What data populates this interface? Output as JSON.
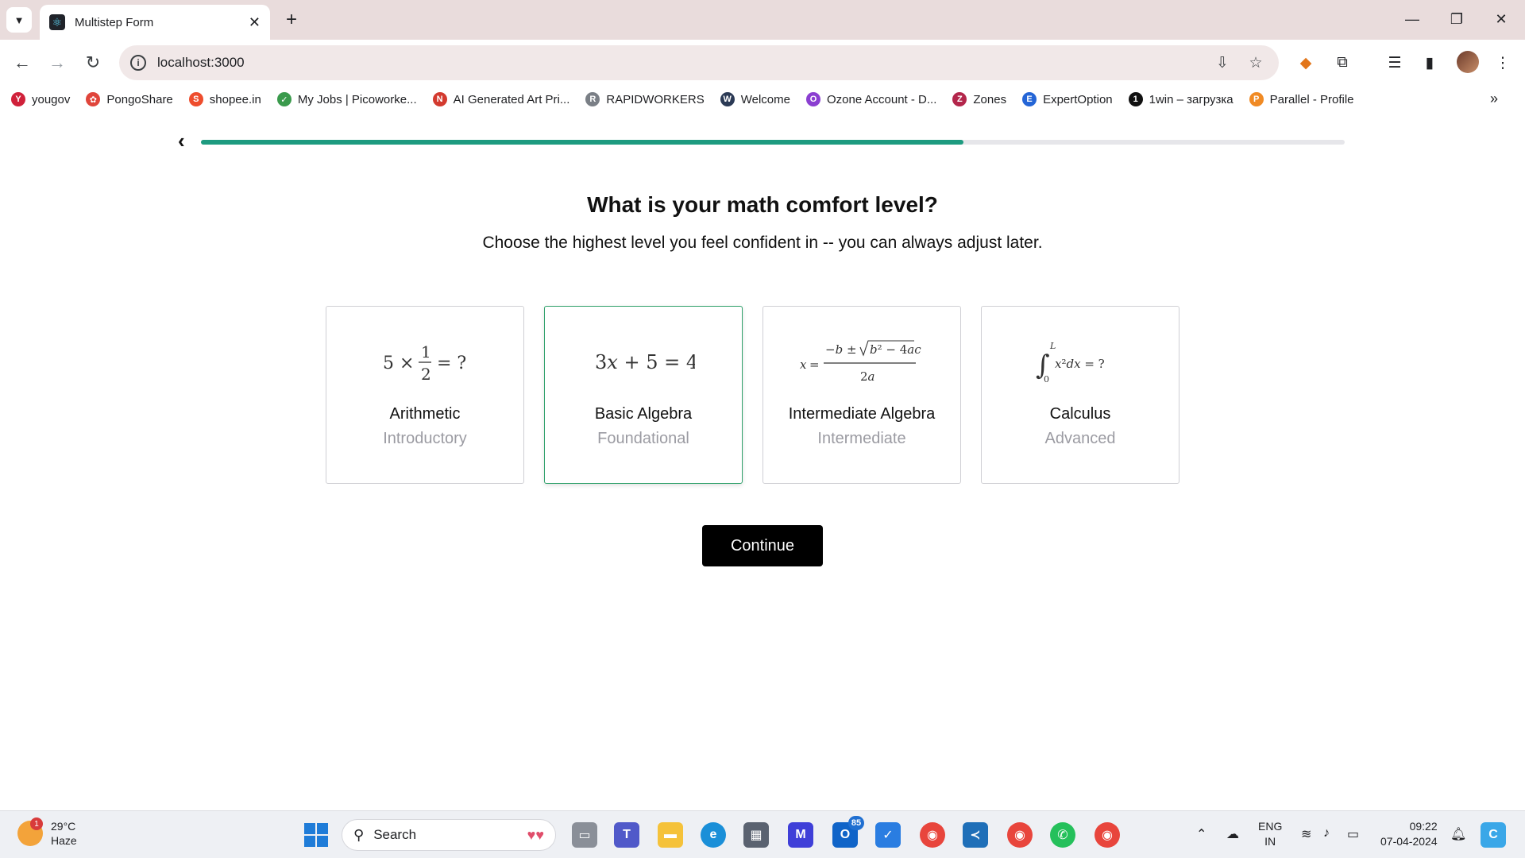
{
  "browser": {
    "tab_title": "Multistep Form",
    "url": "localhost:3000",
    "new_tab_symbol": "+",
    "close_symbol": "✕",
    "bookmarks": [
      {
        "label": "yougov",
        "color": "#d0213a",
        "glyph": "Y"
      },
      {
        "label": "PongoShare",
        "color": "#e0453b",
        "glyph": "✿"
      },
      {
        "label": "shopee.in",
        "color": "#ee4d2d",
        "glyph": "S"
      },
      {
        "label": "My Jobs | Picoworke...",
        "color": "#3a9a4c",
        "glyph": "✓"
      },
      {
        "label": "AI Generated Art Pri...",
        "color": "#d33a2f",
        "glyph": "N"
      },
      {
        "label": "RAPIDWORKERS",
        "color": "#7a7f86",
        "glyph": "R"
      },
      {
        "label": "Welcome",
        "color": "#2b3a55",
        "glyph": "W"
      },
      {
        "label": "Ozone Account - D...",
        "color": "#8b3fd1",
        "glyph": "O"
      },
      {
        "label": "Zones",
        "color": "#b3264b",
        "glyph": "Z"
      },
      {
        "label": "ExpertOption",
        "color": "#2465d6",
        "glyph": "E"
      },
      {
        "label": "1win – загрузка",
        "color": "#111111",
        "glyph": "1"
      },
      {
        "label": "Parallel - Profile",
        "color": "#f08a24",
        "glyph": "P"
      }
    ]
  },
  "form": {
    "progress_fraction": 0.667,
    "title": "What is your math comfort level?",
    "subtitle": "Choose the highest level you feel confident in -- you can always adjust later.",
    "options": [
      {
        "title": "Arithmetic",
        "level": "Introductory",
        "selected": false
      },
      {
        "title": "Basic Algebra",
        "level": "Foundational",
        "selected": true
      },
      {
        "title": "Intermediate Algebra",
        "level": "Intermediate",
        "selected": false
      },
      {
        "title": "Calculus",
        "level": "Advanced",
        "selected": false
      }
    ],
    "continue_label": "Continue"
  },
  "taskbar": {
    "weather_temp": "29°C",
    "weather_desc": "Haze",
    "weather_badge": "1",
    "search_label": "Search",
    "outlook_badge": "85",
    "lang_line1": "ENG",
    "lang_line2": "IN",
    "time": "09:22",
    "date": "07-04-2024"
  },
  "colors": {
    "progress": "#1e9b80",
    "selected_border": "#2ea06a",
    "continue_bg": "#000000"
  }
}
